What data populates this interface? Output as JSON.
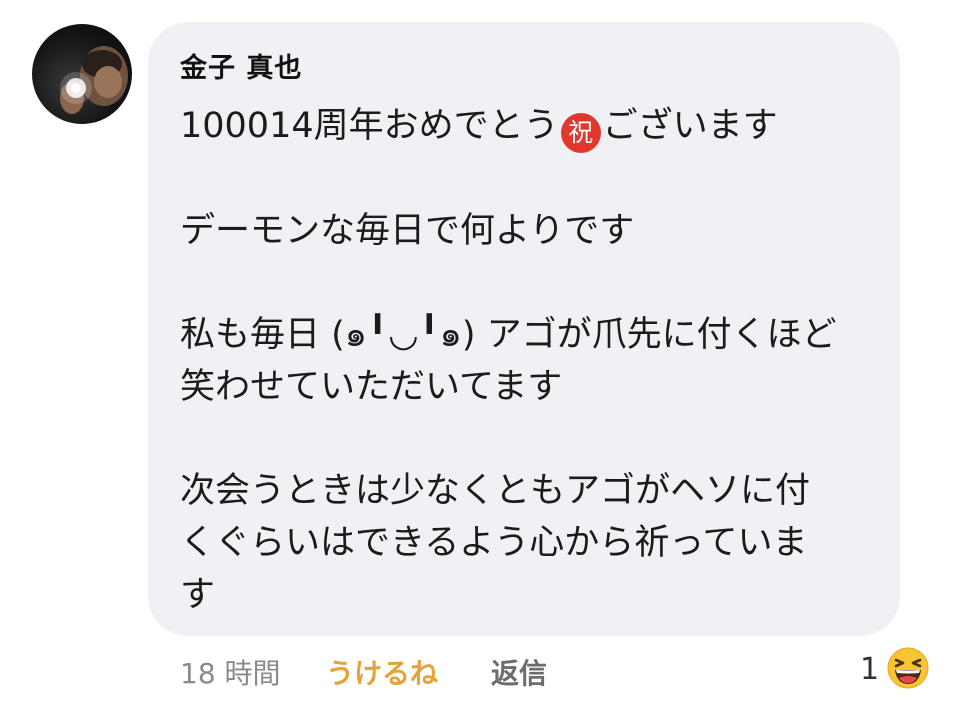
{
  "comment": {
    "author": "金子 真也",
    "lines": {
      "l1_before": "100014周年おめでとう",
      "l1_emoji": "祝",
      "l1_after": "ございます",
      "l2": "デーモンな毎日で何よりです",
      "l3": "私も毎日 (๑╹◡╹๑) アゴが爪先に付くほど",
      "l4": "笑わせていただいてます",
      "l5": "次会うときは少なくともアゴがヘソに付",
      "l6": "くぐらいはできるよう心から祈っていま",
      "l7": "す"
    }
  },
  "footer": {
    "time": "18 時間",
    "like_label": "うけるね",
    "reply_label": "返信",
    "reaction_count": "1",
    "reaction_icon": "laughing-face-icon"
  },
  "colors": {
    "bubble": "#f0f1f4",
    "like_accent": "#e5a33b",
    "celebrate_emoji": "#e0362b",
    "reaction_emoji": "#f7c531"
  }
}
